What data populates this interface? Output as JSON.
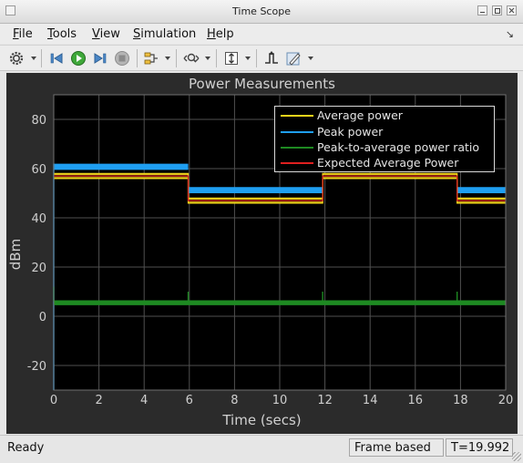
{
  "window": {
    "title": "Time Scope"
  },
  "menu": {
    "items": [
      {
        "key": "F",
        "rest": "ile"
      },
      {
        "key": "T",
        "rest": "ools"
      },
      {
        "key": "V",
        "rest": "iew"
      },
      {
        "key": "S",
        "rest": "imulation"
      },
      {
        "key": "H",
        "rest": "elp"
      }
    ]
  },
  "toolbar": {
    "icons": [
      "settings-gear-icon",
      "step-back-icon",
      "run-icon",
      "step-forward-icon",
      "stop-icon",
      "signal-selector-icon",
      "zoom-icon",
      "scale-axes-icon",
      "triggers-icon",
      "style-icon"
    ]
  },
  "plot": {
    "title": "Power Measurements",
    "xlabel": "Time (secs)",
    "ylabel": "dBm",
    "background": "#000000",
    "panel": "#2b2b2b",
    "grid_color": "#505050"
  },
  "legend": [
    {
      "label": "Average power",
      "color": "#f3d41b"
    },
    {
      "label": "Peak power",
      "color": "#1f9ff2"
    },
    {
      "label": "Peak-to-average power ratio",
      "color": "#1e8a22"
    },
    {
      "label": "Expected Average Power",
      "color": "#e02020"
    }
  ],
  "status": {
    "ready": "Ready",
    "mode": "Frame based",
    "time": "T=19.992"
  },
  "chart_data": {
    "type": "line",
    "title": "Power Measurements",
    "xlabel": "Time (secs)",
    "ylabel": "dBm",
    "xlim": [
      0,
      20
    ],
    "ylim": [
      -30,
      90
    ],
    "xticks": [
      0,
      2,
      4,
      6,
      8,
      10,
      12,
      14,
      16,
      18,
      20
    ],
    "yticks": [
      -20,
      0,
      20,
      40,
      60,
      80
    ],
    "grid": true,
    "legend_position": "top-right",
    "series": [
      {
        "name": "Average power",
        "color": "#f3d41b",
        "x": [
          0,
          5.95,
          5.95,
          11.9,
          11.9,
          17.85,
          17.85,
          20
        ],
        "y_low": [
          56,
          56,
          46,
          46,
          56,
          56,
          46,
          46
        ],
        "y_high": [
          58,
          58,
          48,
          48,
          58,
          58,
          48,
          48
        ]
      },
      {
        "name": "Peak power",
        "color": "#1f9ff2",
        "x": [
          0,
          5.95,
          5.95,
          11.9,
          11.9,
          17.85,
          17.85,
          20
        ],
        "y_low": [
          59.5,
          59.5,
          50,
          50,
          59.5,
          59.5,
          50,
          50
        ],
        "y_high": [
          62,
          62,
          52.5,
          52.5,
          62,
          62,
          52.5,
          52.5
        ]
      },
      {
        "name": "Peak-to-average power ratio",
        "color": "#1e8a22",
        "x": [
          0,
          20
        ],
        "y_low": [
          4.5,
          4.5
        ],
        "y_high": [
          6.5,
          6.5
        ],
        "spikes": [
          5.95,
          11.9,
          17.85
        ]
      },
      {
        "name": "Expected Average Power",
        "color": "#e02020",
        "x": [
          0,
          5.95,
          5.95,
          11.9,
          11.9,
          17.85,
          17.85,
          20
        ],
        "y": [
          57,
          57,
          47,
          47,
          57,
          57,
          47,
          47
        ]
      }
    ]
  }
}
